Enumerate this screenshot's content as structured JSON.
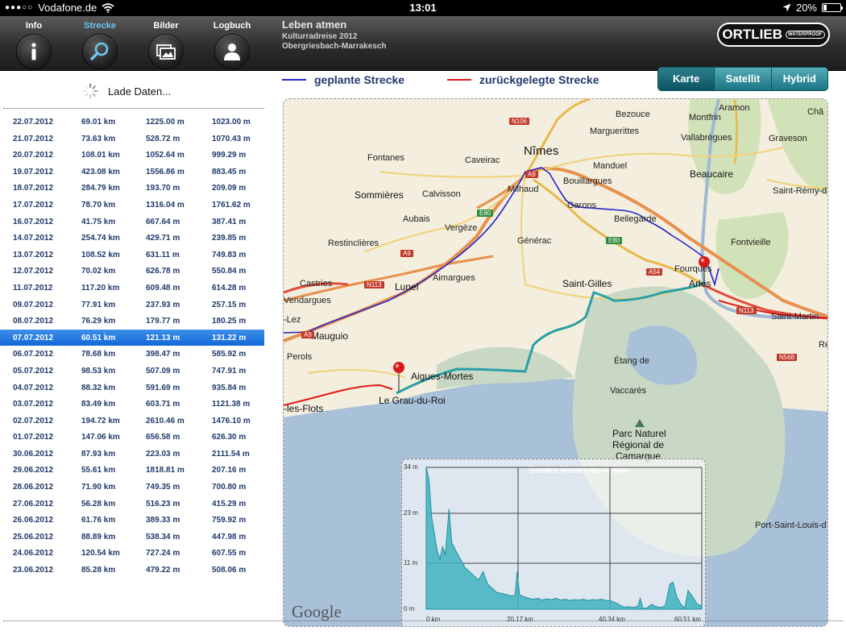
{
  "status_bar": {
    "carrier": "Vodafone.de",
    "time": "13:01",
    "battery": "20%",
    "battery_level": 0.2,
    "icons": [
      "signal-icon",
      "wifi-icon",
      "location-arrow-icon",
      "battery-icon"
    ]
  },
  "nav": {
    "tabs": [
      {
        "label": "Info",
        "icon": "info-icon",
        "active": false
      },
      {
        "label": "Strecke",
        "icon": "search-icon",
        "active": true
      },
      {
        "label": "Bilder",
        "icon": "pictures-icon",
        "active": false
      },
      {
        "label": "Logbuch",
        "icon": "person-icon",
        "active": false
      }
    ],
    "trip": {
      "title": "Leben atmen",
      "subtitle": "Kulturradreise 2012",
      "route": "Obergriesbach-Marrakesch"
    },
    "brand": {
      "name": "ORTLIEB",
      "tag": "WATERPROOF"
    }
  },
  "list": {
    "loading_text": "Lade Daten...",
    "selected_index": 13,
    "rows": [
      [
        "22.07.2012",
        "69.01 km",
        "1225.00 m",
        "1023.00 m"
      ],
      [
        "21.07.2012",
        "73.63 km",
        "528.72 m",
        "1070.43 m"
      ],
      [
        "20.07.2012",
        "108.01 km",
        "1052.64 m",
        "999.29 m"
      ],
      [
        "19.07.2012",
        "423.08 km",
        "1556.86 m",
        "883.45 m"
      ],
      [
        "18.07.2012",
        "284.79 km",
        "193.70 m",
        "209.09 m"
      ],
      [
        "17.07.2012",
        "78.70 km",
        "1316.04 m",
        "1761.62 m"
      ],
      [
        "16.07.2012",
        "41.75 km",
        "667.64 m",
        "387.41 m"
      ],
      [
        "14.07.2012",
        "254.74 km",
        "429.71 m",
        "239.85 m"
      ],
      [
        "13.07.2012",
        "108.52 km",
        "631.11 m",
        "749.83 m"
      ],
      [
        "12.07.2012",
        "70.02 km",
        "626.78 m",
        "550.84 m"
      ],
      [
        "11.07.2012",
        "117.20 km",
        "609.48 m",
        "614.28 m"
      ],
      [
        "09.07.2012",
        "77.91 km",
        "237.93 m",
        "257.15 m"
      ],
      [
        "08.07.2012",
        "76.29 km",
        "179.77 m",
        "180.25 m"
      ],
      [
        "07.07.2012",
        "60.51 km",
        "121.13 m",
        "131.22 m"
      ],
      [
        "06.07.2012",
        "78.68 km",
        "398.47 m",
        "585.92 m"
      ],
      [
        "05.07.2012",
        "98.53 km",
        "507.09 m",
        "747.91 m"
      ],
      [
        "04.07.2012",
        "88.32 km",
        "591.69 m",
        "935.84 m"
      ],
      [
        "03.07.2012",
        "83.49 km",
        "603.71 m",
        "1121.38 m"
      ],
      [
        "02.07.2012",
        "194.72 km",
        "2610.46 m",
        "1476.10 m"
      ],
      [
        "01.07.2012",
        "147.06 km",
        "656.58 m",
        "626.30 m"
      ],
      [
        "30.06.2012",
        "87.93 km",
        "223.03 m",
        "2111.54 m"
      ],
      [
        "29.06.2012",
        "55.61 km",
        "1818.81 m",
        "207.16 m"
      ],
      [
        "28.06.2012",
        "71.90 km",
        "749.35 m",
        "700.80 m"
      ],
      [
        "27.06.2012",
        "56.28 km",
        "516.23 m",
        "415.29 m"
      ],
      [
        "26.06.2012",
        "61.76 km",
        "389.33 m",
        "759.92 m"
      ],
      [
        "25.06.2012",
        "88.89 km",
        "538.34 m",
        "447.98 m"
      ],
      [
        "24.06.2012",
        "120.54 km",
        "727.24 m",
        "607.55 m"
      ],
      [
        "23.06.2012",
        "85.28 km",
        "479.22 m",
        "508.06 m"
      ]
    ]
  },
  "legend": {
    "planned_label": "geplante Strecke",
    "planned_color": "#2424c8",
    "traveled_label": "zurückgelegte Strecke",
    "traveled_color": "#e01b1b"
  },
  "map_type": {
    "options": [
      "Karte",
      "Satellit",
      "Hybrid"
    ],
    "selected": "Karte"
  },
  "map": {
    "attribution": "Google",
    "places": [
      {
        "name": "Bezouce",
        "style": "small"
      },
      {
        "name": "Aramon",
        "style": "small"
      },
      {
        "name": "Marguerittes",
        "style": "small"
      },
      {
        "name": "Montfrin",
        "style": "small"
      },
      {
        "name": "Nîmes",
        "style": "big"
      },
      {
        "name": "Vallabrègues",
        "style": "small"
      },
      {
        "name": "Graveson",
        "style": "small"
      },
      {
        "name": "Fontanes",
        "style": "small"
      },
      {
        "name": "Caveirac",
        "style": "small"
      },
      {
        "name": "Manduel",
        "style": "small"
      },
      {
        "name": "Beaucaire",
        "style": "mid"
      },
      {
        "name": "Sommières",
        "style": "mid"
      },
      {
        "name": "Calvisson",
        "style": "small"
      },
      {
        "name": "Milhaud",
        "style": "small"
      },
      {
        "name": "Bouillargues",
        "style": "small"
      },
      {
        "name": "Saint-Rémy-d",
        "style": "small"
      },
      {
        "name": "Garons",
        "style": "small"
      },
      {
        "name": "Aubais",
        "style": "small"
      },
      {
        "name": "Bellegarde",
        "style": "small"
      },
      {
        "name": "Vergèze",
        "style": "small"
      },
      {
        "name": "Fontvieille",
        "style": "small"
      },
      {
        "name": "Restinclières",
        "style": "small"
      },
      {
        "name": "Générac",
        "style": "small"
      },
      {
        "name": "Fourques",
        "style": "small"
      },
      {
        "name": "Castries",
        "style": "small"
      },
      {
        "name": "Aimargues",
        "style": "small"
      },
      {
        "name": "Saint-Gilles",
        "style": "mid"
      },
      {
        "name": "Arles",
        "style": "mid"
      },
      {
        "name": "Lunel",
        "style": "mid"
      },
      {
        "name": "Vendargues",
        "style": "small"
      },
      {
        "name": "Saint-Martin",
        "style": "small"
      },
      {
        "name": "-Lez",
        "style": "small"
      },
      {
        "name": "Mauguio",
        "style": "mid"
      },
      {
        "name": "Perols",
        "style": "small"
      },
      {
        "name": "Aigues-Mortes",
        "style": "mid"
      },
      {
        "name": "Étang de",
        "style": "small"
      },
      {
        "name": "Vaccarès",
        "style": "small"
      },
      {
        "name": "Le Grau-du-Roi",
        "style": "mid"
      },
      {
        "name": "-les-Flots",
        "style": "mid"
      },
      {
        "name": "Parc Naturel",
        "style": "mid"
      },
      {
        "name": "Régional de",
        "style": "mid"
      },
      {
        "name": "Camargue",
        "style": "mid"
      },
      {
        "name": "Saintes-Maries-de-la-Mer",
        "style": "small"
      },
      {
        "name": "Port-Saint-Louis-d",
        "style": "small"
      },
      {
        "name": "Châ",
        "style": "small"
      },
      {
        "name": "Ré",
        "style": "small"
      }
    ],
    "road_tags": [
      {
        "name": "N106",
        "color": "red"
      },
      {
        "name": "A9",
        "color": "red"
      },
      {
        "name": "E80",
        "color": "green"
      },
      {
        "name": "E80",
        "color": "green"
      },
      {
        "name": "A9",
        "color": "red"
      },
      {
        "name": "A54",
        "color": "red"
      },
      {
        "name": "N113",
        "color": "red"
      },
      {
        "name": "A9",
        "color": "red"
      },
      {
        "name": "N113",
        "color": "red"
      },
      {
        "name": "N568",
        "color": "red"
      }
    ]
  },
  "elevation_profile": {
    "y_ticks": [
      "34 m",
      "23 m",
      "11 m",
      "0 m"
    ],
    "x_ticks": [
      "0 km",
      "20.17 km",
      "40.34 km",
      "60.51 km"
    ],
    "background_label": "Saintes-Maries-de-la-Mer",
    "fill_color": "#3fb3bf",
    "ylim": [
      0,
      34
    ],
    "xlim": [
      0,
      60.51
    ],
    "points": [
      [
        0,
        34
      ],
      [
        0.6,
        31
      ],
      [
        1.2,
        22
      ],
      [
        1.8,
        18
      ],
      [
        2.4,
        14
      ],
      [
        3,
        12
      ],
      [
        3.6,
        15
      ],
      [
        4.2,
        13
      ],
      [
        5,
        24
      ],
      [
        5.6,
        16
      ],
      [
        6.5,
        14
      ],
      [
        7.5,
        12
      ],
      [
        8.5,
        10
      ],
      [
        9.5,
        9
      ],
      [
        10.5,
        8
      ],
      [
        11.5,
        7
      ],
      [
        12.5,
        9
      ],
      [
        13.5,
        6
      ],
      [
        14.5,
        5
      ],
      [
        15.5,
        4
      ],
      [
        16.5,
        3.8
      ],
      [
        17.5,
        3.5
      ],
      [
        18.5,
        3.2
      ],
      [
        19.5,
        3.3
      ],
      [
        20,
        9
      ],
      [
        20.5,
        3.4
      ],
      [
        21.5,
        3
      ],
      [
        22.5,
        2.6
      ],
      [
        23.5,
        2.4
      ],
      [
        24.5,
        2.6
      ],
      [
        25.5,
        2.2
      ],
      [
        26.5,
        2.5
      ],
      [
        27.5,
        2.3
      ],
      [
        28.5,
        2.6
      ],
      [
        29.5,
        2.2
      ],
      [
        30.5,
        2.4
      ],
      [
        31.5,
        2.1
      ],
      [
        32.5,
        2.3
      ],
      [
        33.5,
        2.2
      ],
      [
        34.5,
        2.4
      ],
      [
        35.5,
        2.1
      ],
      [
        36.5,
        2.3
      ],
      [
        37.5,
        2.2
      ],
      [
        38.5,
        2.4
      ],
      [
        39.5,
        2.1
      ],
      [
        40.5,
        2.0
      ],
      [
        41.5,
        1.6
      ],
      [
        42.5,
        1.0
      ],
      [
        43.5,
        0.5
      ],
      [
        44.5,
        0.6
      ],
      [
        45.5,
        0.4
      ],
      [
        46.5,
        0.7
      ],
      [
        47,
        2.6
      ],
      [
        47.6,
        0.2
      ],
      [
        48.5,
        0.3
      ],
      [
        49.5,
        1.2
      ],
      [
        50.5,
        0.6
      ],
      [
        51.5,
        0.4
      ],
      [
        52.5,
        0.8
      ],
      [
        53.5,
        6
      ],
      [
        54.2,
        6.5
      ],
      [
        55,
        3
      ],
      [
        56,
        1
      ],
      [
        56.8,
        0.3
      ],
      [
        57.5,
        4.5
      ],
      [
        58.5,
        3
      ],
      [
        59.5,
        1.2
      ],
      [
        60.51,
        0.8
      ]
    ]
  }
}
